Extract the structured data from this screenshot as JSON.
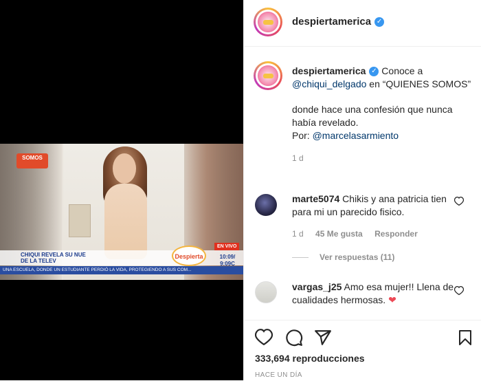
{
  "video": {
    "somos_logo": "SOMOS",
    "headline": "CHIQUI REVELA SU NUE DE LA TELEV",
    "live_badge": "EN VIVO",
    "show_logo": "Despierta",
    "clock_time": "10:09/",
    "clock_time2": "9:09C",
    "ticker": "UNA ESCUELA, DONDE UN ESTUDIANTE PERDIÓ LA VIDA, PROTEGIENDO A SUS COM..."
  },
  "header": {
    "username": "despiertamerica",
    "verified_icon": "verified-badge-icon"
  },
  "caption": {
    "username": "despiertamerica",
    "text1": "Conoce a",
    "mention1": "@chiqui_delgado",
    "text2": "en “QUIENES SOMOS”",
    "paragraph2": "donde hace una confesión que nunca había revelado.",
    "por_label": "Por:",
    "mention2": "@marcelasarmiento",
    "time": "1 d"
  },
  "comments": [
    {
      "username": "marte5074",
      "text": "Chikis y ana patricia tien para mi un parecido fisico.",
      "time": "1 d",
      "likes": "45 Me gusta",
      "reply_label": "Responder",
      "view_replies": "Ver respuestas (11)"
    },
    {
      "username": "vargas_j25",
      "text": "Amo esa mujer!! Llena de cualidades hermosas.",
      "emoji": "❤️"
    }
  ],
  "actions": {
    "icons": [
      "heart-icon",
      "comment-icon",
      "share-icon",
      "bookmark-icon"
    ],
    "views": "333,694 reproducciones",
    "posted": "HACE UN DÍA"
  },
  "colors": {
    "mention": "#00376b",
    "muted": "#8e8e8e",
    "verified": "#3897f0",
    "heart_red": "#ed4956"
  }
}
